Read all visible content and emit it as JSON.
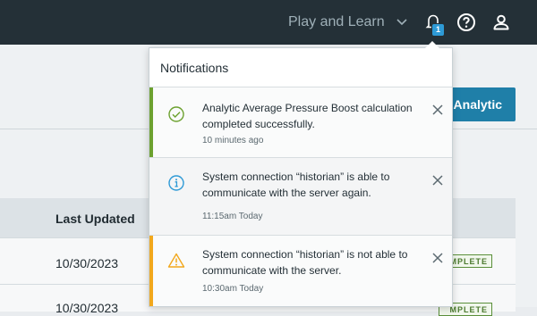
{
  "topbar": {
    "menu_label": "Play and Learn",
    "notification_count": "1",
    "icons": {
      "chevron": "chevron-down-icon",
      "bell": "bell-icon",
      "help": "help-icon",
      "user": "user-icon"
    }
  },
  "page": {
    "primary_button_label": "Analytic",
    "table": {
      "columns": [
        "Last Updated"
      ],
      "rows": [
        {
          "last_updated": "10/30/2023",
          "status": "MPLETE"
        },
        {
          "last_updated": "10/30/2023",
          "status": "MPLETE"
        }
      ]
    }
  },
  "notifications": {
    "title": "Notifications",
    "items": [
      {
        "type": "success",
        "icon": "check-circle-icon",
        "accent": "#6ca12f",
        "message": "Analytic Average Pressure Boost calculation completed successfully.",
        "time": "10 minutes ago"
      },
      {
        "type": "info",
        "icon": "info-circle-icon",
        "accent": "#2e9ad6",
        "message": "System connection “historian” is able to communicate with the server again.",
        "time": "11:15am Today"
      },
      {
        "type": "warning",
        "icon": "warning-triangle-icon",
        "accent": "#f2a81d",
        "message": "System connection “historian” is not able to communicate with the server.",
        "time": "10:30am Today"
      }
    ]
  },
  "colors": {
    "topbar": "#243037",
    "success": "#6ca12f",
    "info": "#2e9ad6",
    "warning": "#f2a81d",
    "primary_button": "#1f7fa8"
  }
}
